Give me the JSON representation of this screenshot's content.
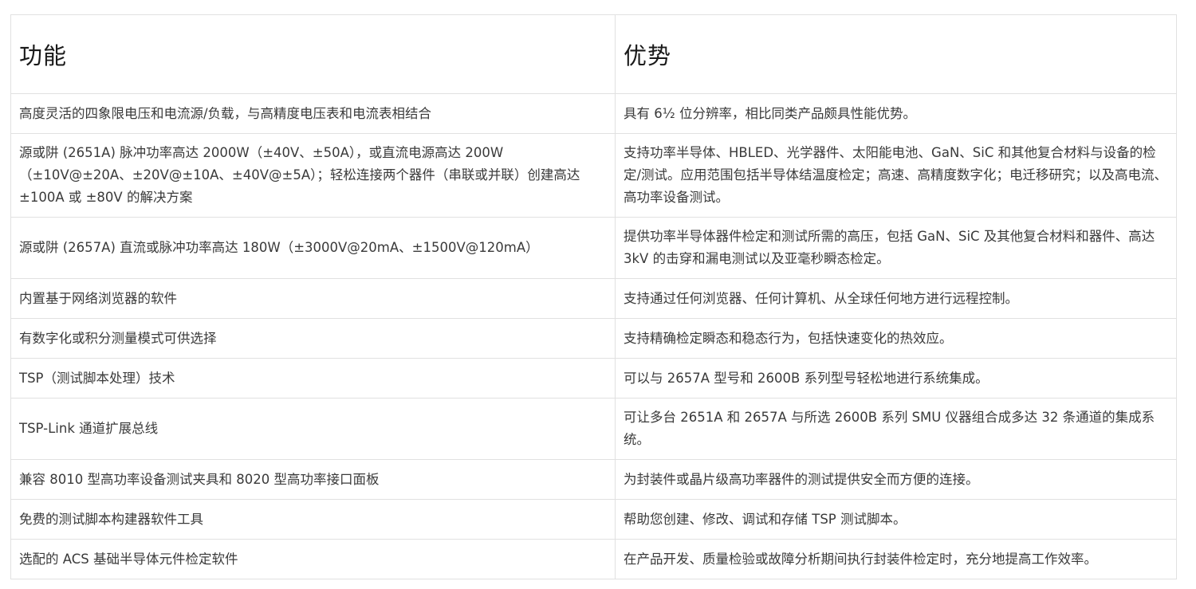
{
  "table": {
    "headers": {
      "feature": "功能",
      "advantage": "优势"
    },
    "rows": [
      {
        "feature": "高度灵活的四象限电压和电流源/负载，与高精度电压表和电流表相结合",
        "advantage": "具有 6½ 位分辨率，相比同类产品颇具性能优势。"
      },
      {
        "feature": "源或阱 (2651A) 脉冲功率高达 2000W（±40V、±50A），或直流电源高达 200W（±10V@±20A、±20V@±10A、±40V@±5A）；轻松连接两个器件（串联或并联）创建高达 ±100A 或 ±80V 的解决方案",
        "advantage": "支持功率半导体、HBLED、光学器件、太阳能电池、GaN、SiC 和其他复合材料与设备的检定/测试。应用范围包括半导体结温度检定；高速、高精度数字化；电迁移研究；以及高电流、高功率设备测试。"
      },
      {
        "feature": "源或阱 (2657A) 直流或脉冲功率高达 180W（±3000V@20mA、±1500V@120mA）",
        "advantage": "提供功率半导体器件检定和测试所需的高压，包括 GaN、SiC 及其他复合材料和器件、高达 3kV 的击穿和漏电测试以及亚毫秒瞬态检定。"
      },
      {
        "feature": "内置基于网络浏览器的软件",
        "advantage": "支持通过任何浏览器、任何计算机、从全球任何地方进行远程控制。"
      },
      {
        "feature": "有数字化或积分测量模式可供选择",
        "advantage": "支持精确检定瞬态和稳态行为，包括快速变化的热效应。"
      },
      {
        "feature": "TSP（测试脚本处理）技术",
        "advantage": "可以与 2657A 型号和 2600B 系列型号轻松地进行系统集成。"
      },
      {
        "feature": "TSP-Link 通道扩展总线",
        "advantage": "可让多台 2651A 和 2657A 与所选 2600B 系列 SMU 仪器组合成多达 32 条通道的集成系统。"
      },
      {
        "feature": "兼容 8010 型高功率设备测试夹具和 8020 型高功率接口面板",
        "advantage": "为封装件或晶片级高功率器件的测试提供安全而方便的连接。"
      },
      {
        "feature": "免费的测试脚本构建器软件工具",
        "advantage": "帮助您创建、修改、调试和存储 TSP 测试脚本。"
      },
      {
        "feature": "选配的 ACS 基础半导体元件检定软件",
        "advantage": "在产品开发、质量检验或故障分析期间执行封装件检定时，充分地提高工作效率。"
      }
    ]
  }
}
